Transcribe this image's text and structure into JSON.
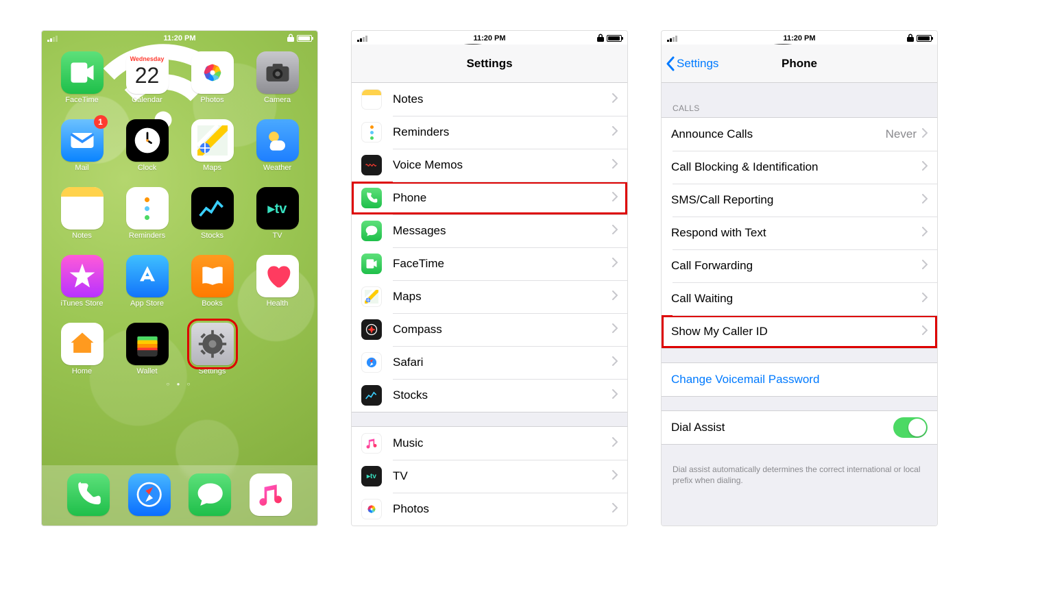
{
  "status": {
    "time": "11:20 PM"
  },
  "home": {
    "apps": [
      {
        "name": "FaceTime",
        "icon": "facetime"
      },
      {
        "name": "Calendar",
        "icon": "calendar",
        "cal_day": "Wednesday",
        "cal_date": "22"
      },
      {
        "name": "Photos",
        "icon": "photos"
      },
      {
        "name": "Camera",
        "icon": "camera"
      },
      {
        "name": "Mail",
        "icon": "mail",
        "badge": "1"
      },
      {
        "name": "Clock",
        "icon": "clock"
      },
      {
        "name": "Maps",
        "icon": "maps"
      },
      {
        "name": "Weather",
        "icon": "weather"
      },
      {
        "name": "Notes",
        "icon": "notes"
      },
      {
        "name": "Reminders",
        "icon": "reminders"
      },
      {
        "name": "Stocks",
        "icon": "stocks"
      },
      {
        "name": "TV",
        "icon": "tv",
        "glyph": "▸tv"
      },
      {
        "name": "iTunes Store",
        "icon": "itunes"
      },
      {
        "name": "App Store",
        "icon": "appstore"
      },
      {
        "name": "Books",
        "icon": "books"
      },
      {
        "name": "Health",
        "icon": "health"
      },
      {
        "name": "Home",
        "icon": "home"
      },
      {
        "name": "Wallet",
        "icon": "wallet"
      },
      {
        "name": "Settings",
        "icon": "settings",
        "highlight": true
      }
    ],
    "dock": [
      {
        "name": "Phone",
        "icon": "phone"
      },
      {
        "name": "Safari",
        "icon": "safari"
      },
      {
        "name": "Messages",
        "icon": "messages"
      },
      {
        "name": "Music",
        "icon": "music"
      }
    ]
  },
  "settings_root": {
    "title": "Settings",
    "groups": [
      {
        "rows": [
          {
            "label": "Notes",
            "icon": "notes"
          },
          {
            "label": "Reminders",
            "icon": "reminders"
          },
          {
            "label": "Voice Memos",
            "icon": "voicememos"
          },
          {
            "label": "Phone",
            "icon": "phone",
            "highlight": true
          },
          {
            "label": "Messages",
            "icon": "messages"
          },
          {
            "label": "FaceTime",
            "icon": "facetime"
          },
          {
            "label": "Maps",
            "icon": "maps"
          },
          {
            "label": "Compass",
            "icon": "compass"
          },
          {
            "label": "Safari",
            "icon": "safari"
          },
          {
            "label": "Stocks",
            "icon": "stocks"
          }
        ]
      },
      {
        "rows": [
          {
            "label": "Music",
            "icon": "music"
          },
          {
            "label": "TV",
            "icon": "tv"
          },
          {
            "label": "Photos",
            "icon": "photos"
          }
        ]
      }
    ]
  },
  "phone_settings": {
    "back_label": "Settings",
    "title": "Phone",
    "calls_header": "CALLS",
    "calls": [
      {
        "label": "Announce Calls",
        "detail": "Never"
      },
      {
        "label": "Call Blocking & Identification"
      },
      {
        "label": "SMS/Call Reporting"
      },
      {
        "label": "Respond with Text"
      },
      {
        "label": "Call Forwarding"
      },
      {
        "label": "Call Waiting"
      },
      {
        "label": "Show My Caller ID",
        "highlight": true
      }
    ],
    "voicemail_label": "Change Voicemail Password",
    "dial_assist_label": "Dial Assist",
    "dial_assist_note": "Dial assist automatically determines the correct international or local prefix when dialing."
  }
}
